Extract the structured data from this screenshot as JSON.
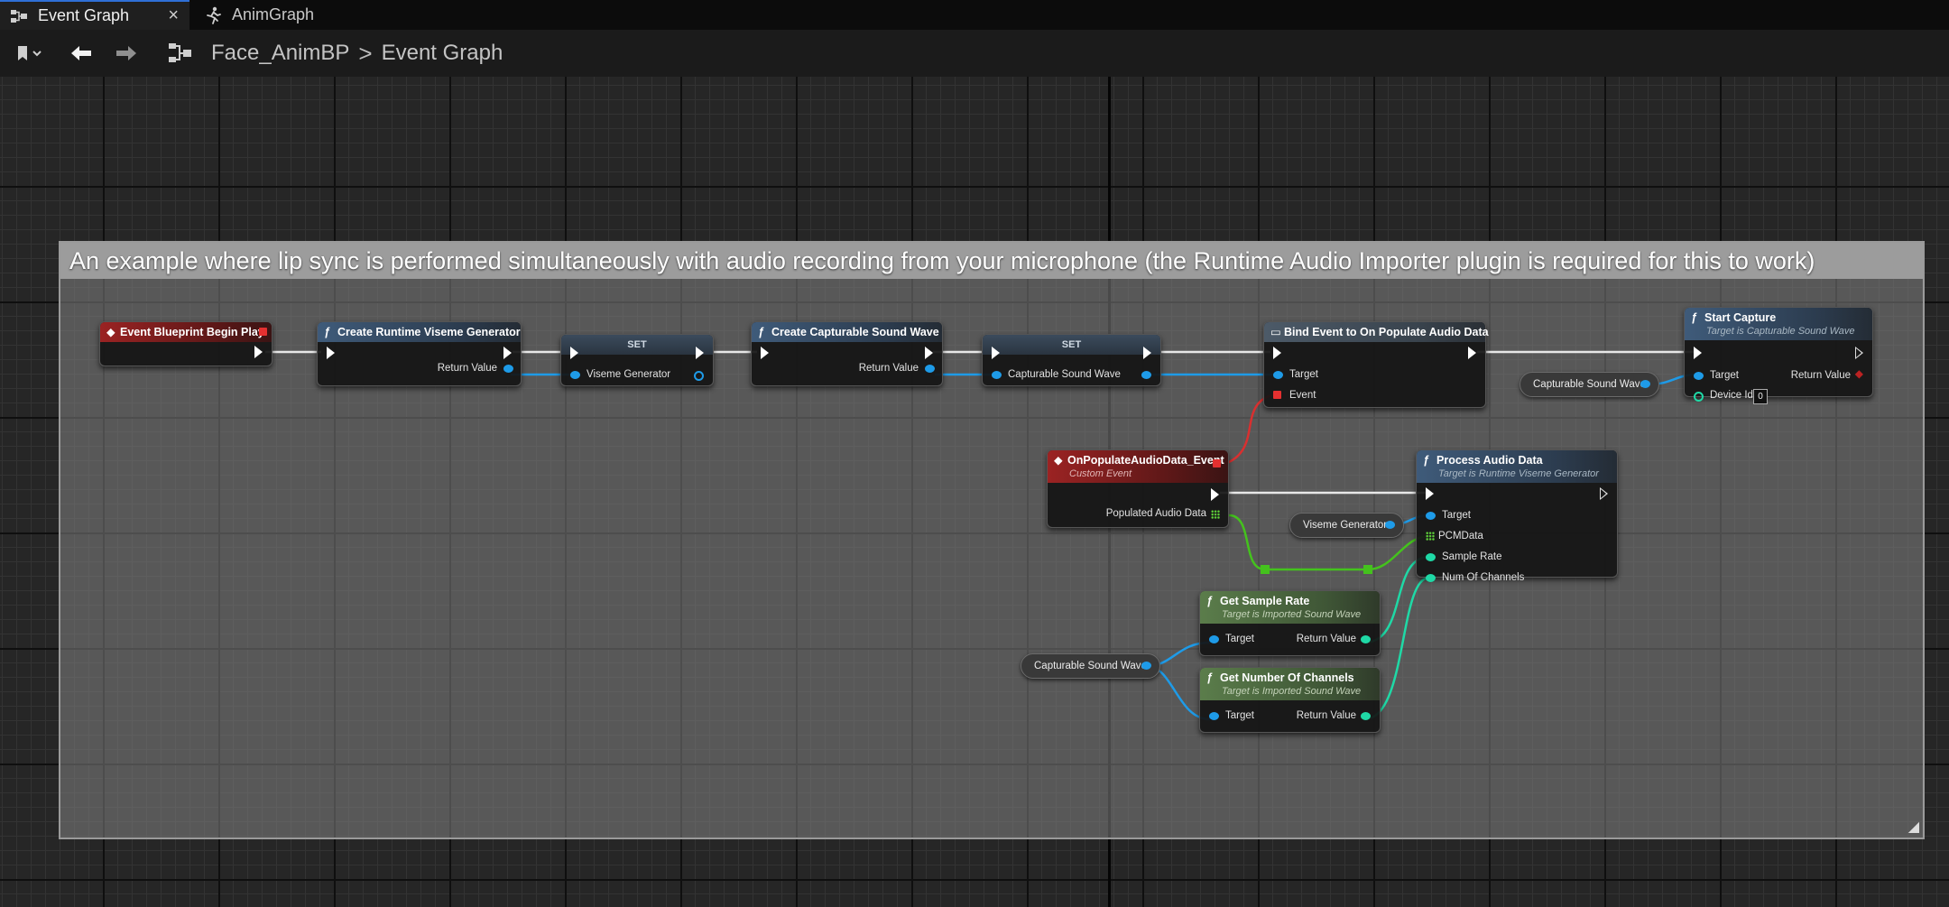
{
  "tabs": [
    {
      "label": "Event Graph",
      "icon": "event-graph-icon",
      "active": true,
      "close": "×"
    },
    {
      "label": "AnimGraph",
      "icon": "run-icon",
      "active": false
    }
  ],
  "toolbar": {
    "breadcrumb": [
      "Face_AnimBP",
      "Event Graph"
    ],
    "separator": ">"
  },
  "comment": {
    "title": "An example where lip sync is performed simultaneously with audio recording from your microphone (the Runtime Audio Importer plugin is required for this to work)"
  },
  "nodes": {
    "begin_play": {
      "title": "Event Blueprint Begin Play"
    },
    "create_viseme": {
      "title": "Create Runtime Viseme Generator",
      "out": "Return Value"
    },
    "set_viseme": {
      "title": "SET",
      "in": "Viseme Generator"
    },
    "create_capturable": {
      "title": "Create Capturable Sound Wave",
      "out": "Return Value"
    },
    "set_capturable": {
      "title": "SET",
      "in": "Capturable Sound Wave"
    },
    "bind_event": {
      "title": "Bind Event to On Populate Audio Data",
      "target": "Target",
      "event": "Event"
    },
    "start_capture": {
      "title": "Start Capture",
      "subtitle": "Target is Capturable Sound Wave",
      "target": "Target",
      "ret": "Return Value",
      "device": "Device Id",
      "device_value": "0"
    },
    "custom_event": {
      "title": "OnPopulateAudioData_Event",
      "subtitle": "Custom Event",
      "out": "Populated Audio Data"
    },
    "process_audio": {
      "title": "Process Audio Data",
      "subtitle": "Target is Runtime Viseme Generator",
      "target": "Target",
      "pcm": "PCMData",
      "rate": "Sample Rate",
      "channels": "Num Of Channels"
    },
    "get_sample_rate": {
      "title": "Get Sample Rate",
      "subtitle": "Target is Imported Sound Wave",
      "target": "Target",
      "ret": "Return Value"
    },
    "get_channels": {
      "title": "Get Number Of Channels",
      "subtitle": "Target is Imported Sound Wave",
      "target": "Target",
      "ret": "Return Value"
    }
  },
  "vars": {
    "capturable_a": "Capturable Sound Wave",
    "viseme_gen": "Viseme Generator",
    "capturable_b": "Capturable Sound Wave"
  },
  "colors": {
    "exec": "#ffffff",
    "object_pin": "#1e9be8",
    "int_pin": "#1fd9a6",
    "delegate_pin": "#e53030",
    "array_pin": "#5fd23a",
    "accent_tab": "#2f6fd6"
  }
}
